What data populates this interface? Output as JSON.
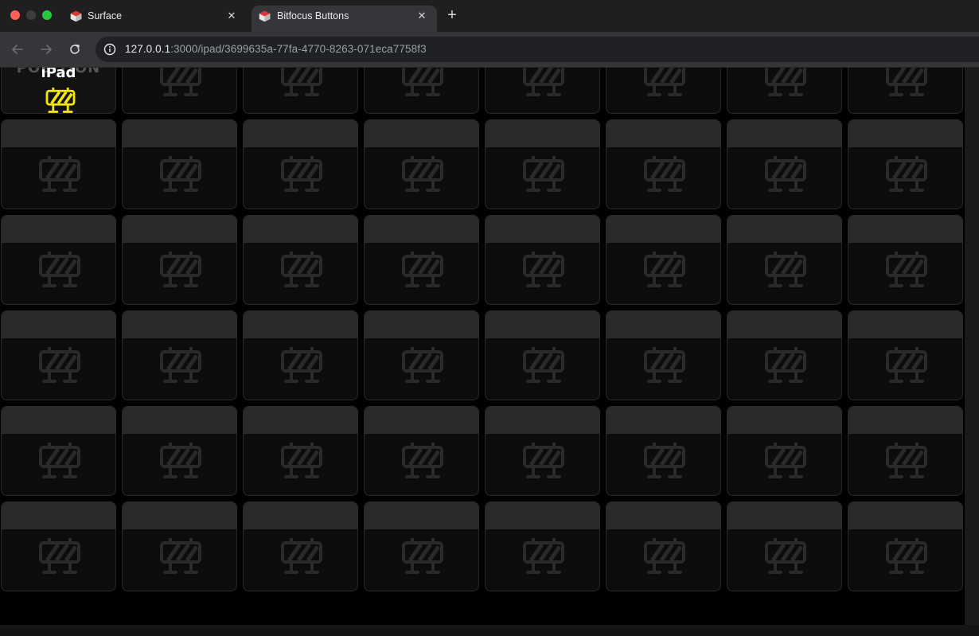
{
  "browser": {
    "tabs": [
      {
        "title": "Surface",
        "active": false
      },
      {
        "title": "Bitfocus Buttons",
        "active": true
      }
    ],
    "url_host": "127.0.0.1",
    "url_rest": ":3000/ipad/3699635a-77fa-4770-8263-071eca7758f3"
  },
  "surface": {
    "first_button": {
      "heading": "NO POSITION",
      "label": "iPad",
      "icon": "barrier-icon",
      "icon_color": "#f5e50a"
    },
    "placeholder_icon": "barrier-icon",
    "placeholder_color": "#2a2a2a",
    "columns": 8,
    "rows": 6
  }
}
